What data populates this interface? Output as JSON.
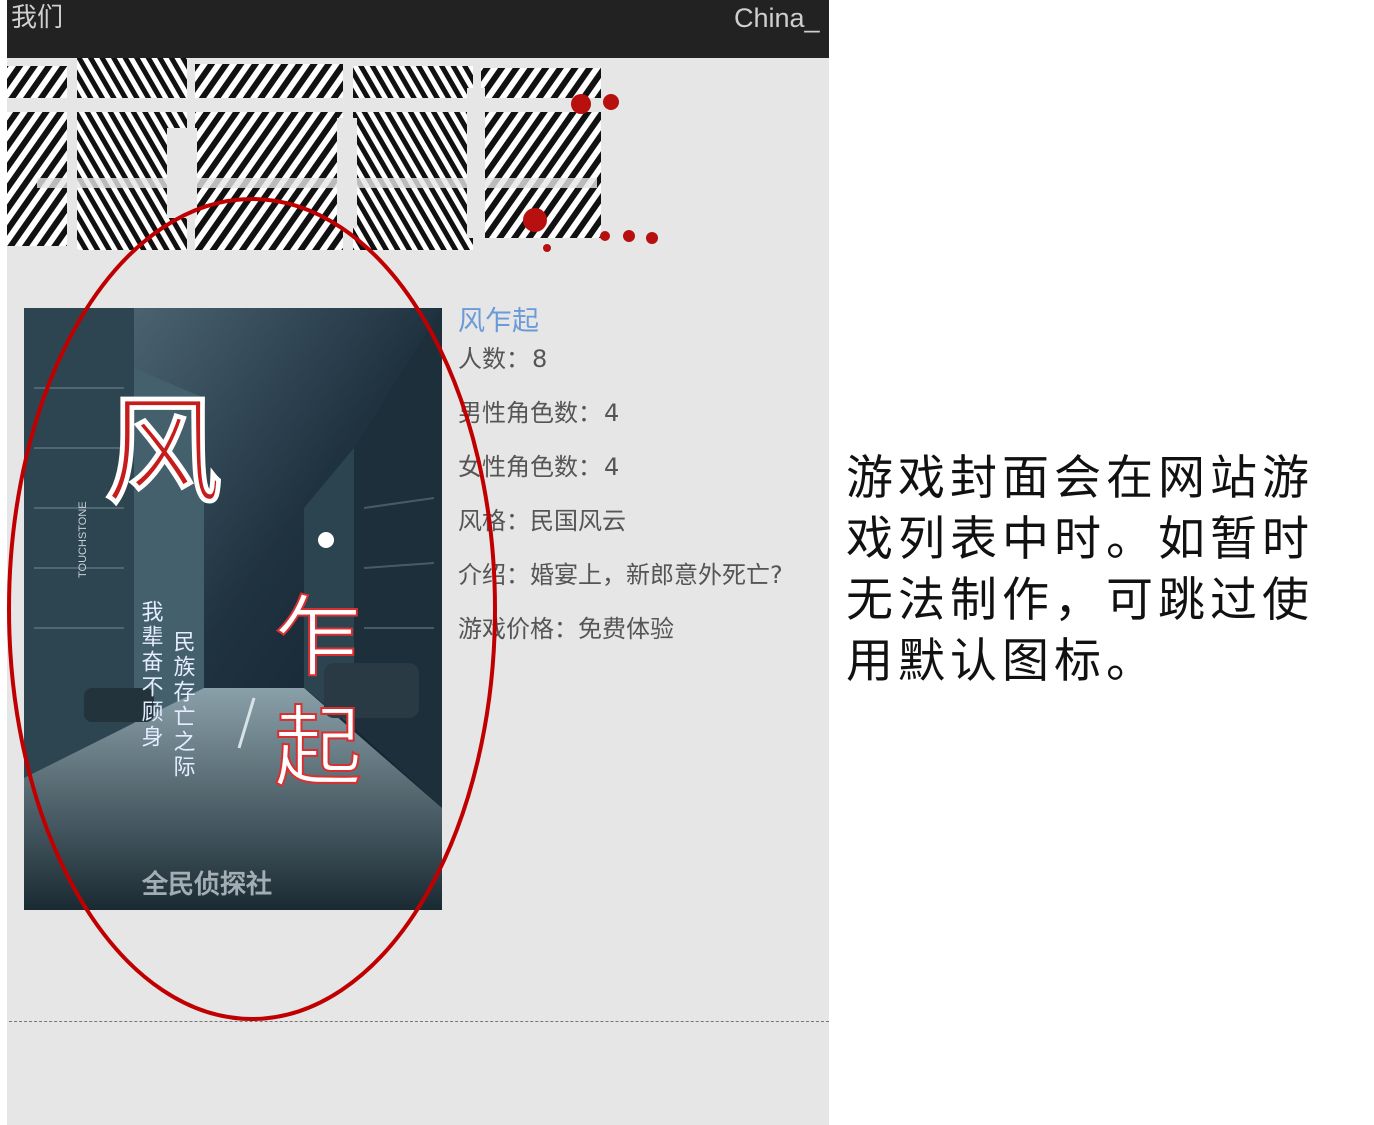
{
  "topbar": {
    "left_label": "我们",
    "right_label": "China_"
  },
  "logo": {
    "text": "全民侦探社",
    "accent": "#b80f0f"
  },
  "cover": {
    "title_char_1": "风",
    "title_char_2": "乍",
    "title_char_3": "起",
    "tagline_1": "民族存亡之际",
    "tagline_2": "我辈奋不顾身",
    "publisher": "全民侦探社",
    "shop_sign": "TOUCHSTONE"
  },
  "game": {
    "title": "风乍起",
    "players_label": "人数：",
    "players": "8",
    "male_label": "男性角色数：",
    "male": "4",
    "female_label": "女性角色数：",
    "female": "4",
    "style_label": "风格：",
    "style": "民国风云",
    "intro_label": "介绍：",
    "intro": "婚宴上，新郎意外死亡?",
    "price_label": "游戏价格：",
    "price": "免费体验"
  },
  "annotation": {
    "text": "游戏封面会在网站游戏列表中时。如暂时无法制作，可跳过使用默认图标。",
    "ellipse_color": "#c00000"
  }
}
